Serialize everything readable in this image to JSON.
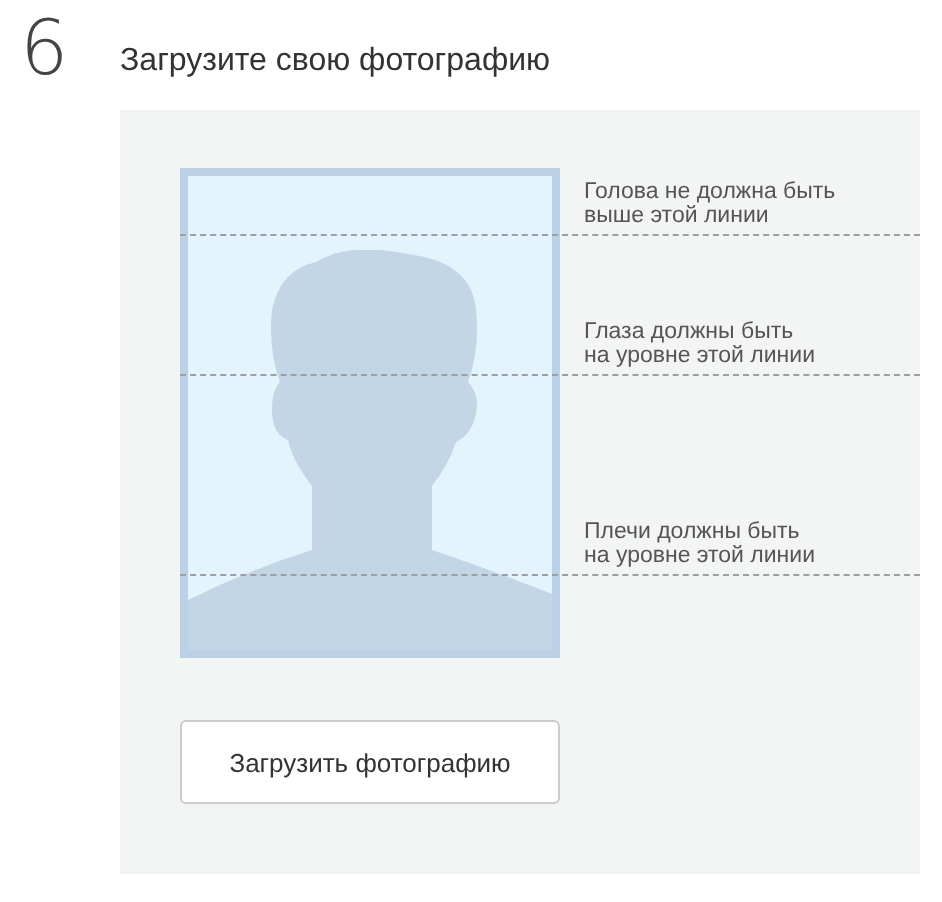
{
  "step": {
    "number": "6",
    "title": "Загрузите свою фотографию"
  },
  "guides": [
    {
      "label": "Голова не должна быть\nвыше этой линии"
    },
    {
      "label": "Глаза должны быть\nна уровне этой линии"
    },
    {
      "label": "Плечи должны быть\nна уровне этой линии"
    }
  ],
  "upload_button": "Загрузить фотографию"
}
